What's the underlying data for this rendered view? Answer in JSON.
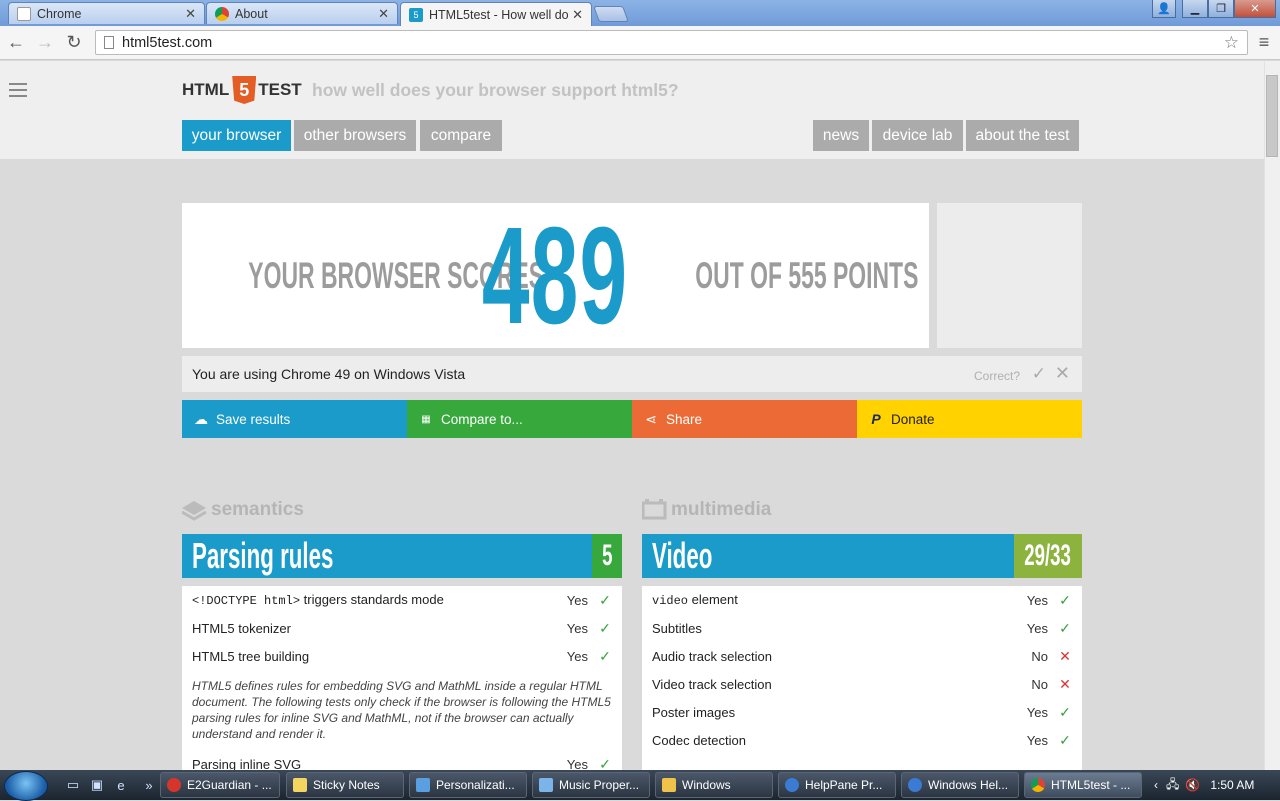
{
  "browser": {
    "tabs": [
      {
        "title": "Chrome",
        "icon": "page-icon"
      },
      {
        "title": "About",
        "icon": "chrome-icon"
      },
      {
        "title": "HTML5test - How well do",
        "icon": "html5test-icon"
      }
    ],
    "address": "html5test.com"
  },
  "site": {
    "logo_left": "HTML",
    "logo_mid": "5",
    "logo_right": "TEST",
    "tagline": "how well does your browser support html5?",
    "nav_left": [
      "your browser",
      "other browsers",
      "compare"
    ],
    "nav_right": [
      "news",
      "device lab",
      "about the test"
    ]
  },
  "score": {
    "prefix": "YOUR BROWSER SCORES",
    "value": "489",
    "suffix": "OUT OF 555 POINTS"
  },
  "using": {
    "text": "You are using Chrome 49 on Windows Vista",
    "correct_label": "Correct?"
  },
  "actions": [
    {
      "label": "Save results",
      "color": "#1a9bc9",
      "icon": "cloud-upload-icon"
    },
    {
      "label": "Compare to...",
      "color": "#37a83c",
      "icon": "grid-icon"
    },
    {
      "label": "Share",
      "color": "#ec6a35",
      "icon": "share-icon"
    },
    {
      "label": "Donate",
      "color": "#ffd200",
      "icon": "paypal-icon"
    }
  ],
  "sections": {
    "left": {
      "heading": "semantics",
      "category": "Parsing rules",
      "score": "5",
      "rows": [
        {
          "code": "<!DOCTYPE html>",
          "label": " triggers standards mode",
          "result": "Yes",
          "pass": true
        },
        {
          "label": "HTML5 tokenizer",
          "result": "Yes",
          "pass": true
        },
        {
          "label": "HTML5 tree building",
          "result": "Yes",
          "pass": true
        }
      ],
      "note": "HTML5 defines rules for embedding SVG and MathML inside a regular HTML document. The following tests only check if the browser is following the HTML5 parsing rules for inline SVG and MathML, not if the browser can actually understand and render it.",
      "partial_row": {
        "label": "Parsing inline SVG",
        "result": "Yes"
      }
    },
    "right": {
      "heading": "multimedia",
      "category": "Video",
      "score": "29/33",
      "rows": [
        {
          "code": "video",
          "label": " element",
          "result": "Yes",
          "pass": true
        },
        {
          "label": "Subtitles",
          "result": "Yes",
          "pass": true
        },
        {
          "label": "Audio track selection",
          "result": "No",
          "pass": false
        },
        {
          "label": "Video track selection",
          "result": "No",
          "pass": false
        },
        {
          "label": "Poster images",
          "result": "Yes",
          "pass": true
        },
        {
          "label": "Codec detection",
          "result": "Yes",
          "pass": true
        }
      ]
    }
  },
  "taskbar": {
    "items": [
      {
        "label": "E2Guardian - ...",
        "color": "#d6352b"
      },
      {
        "label": "Sticky Notes",
        "color": "#f3d660"
      },
      {
        "label": "Personalizati...",
        "color": "#5aa0e0"
      },
      {
        "label": "Music Proper...",
        "color": "#7ab4e8"
      },
      {
        "label": "Windows",
        "color": "#f0c24a"
      },
      {
        "label": "HelpPane Pr...",
        "color": "#3b7bd4"
      },
      {
        "label": "Windows Hel...",
        "color": "#3b7bd4"
      },
      {
        "label": "HTML5test - ...",
        "color": "#4aa0e0"
      }
    ],
    "clock": "1:50 AM"
  }
}
